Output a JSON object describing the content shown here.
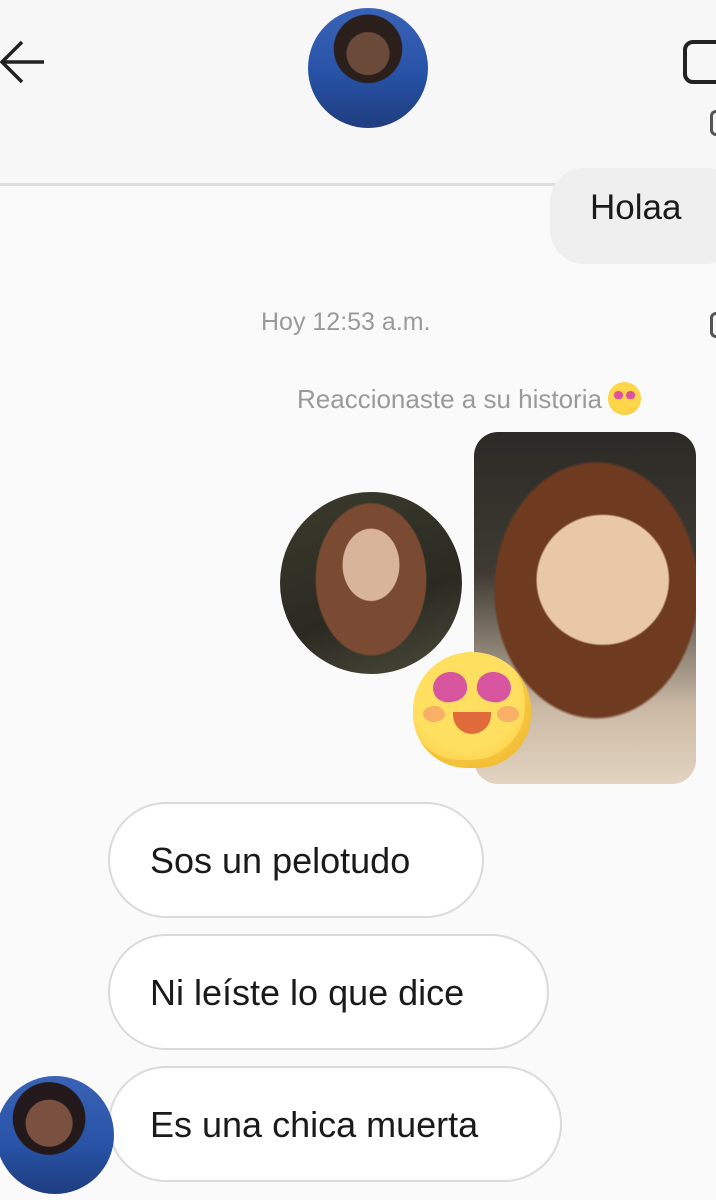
{
  "header": {
    "back_icon": "arrow-left-icon",
    "avatar": "contact-avatar",
    "video_icon": "video-call-icon"
  },
  "messages": {
    "sent_text": "Holaa",
    "timestamp": "Hoy 12:53 a.m.",
    "story_reaction_note": "Reaccionaste a su historia",
    "reaction_emoji": "heart-eyes-emoji-icon",
    "replies": [
      "Sos un pelotudo",
      "Ni leíste lo que dice",
      "Es una chica muerta"
    ]
  },
  "colors": {
    "background": "#fafafa",
    "bubble_gray": "#efefef",
    "meta_text": "#9a9a9a",
    "pill_border": "#dadada",
    "emoji_yellow": "#ffd54a",
    "emoji_pink": "#d7559f"
  }
}
